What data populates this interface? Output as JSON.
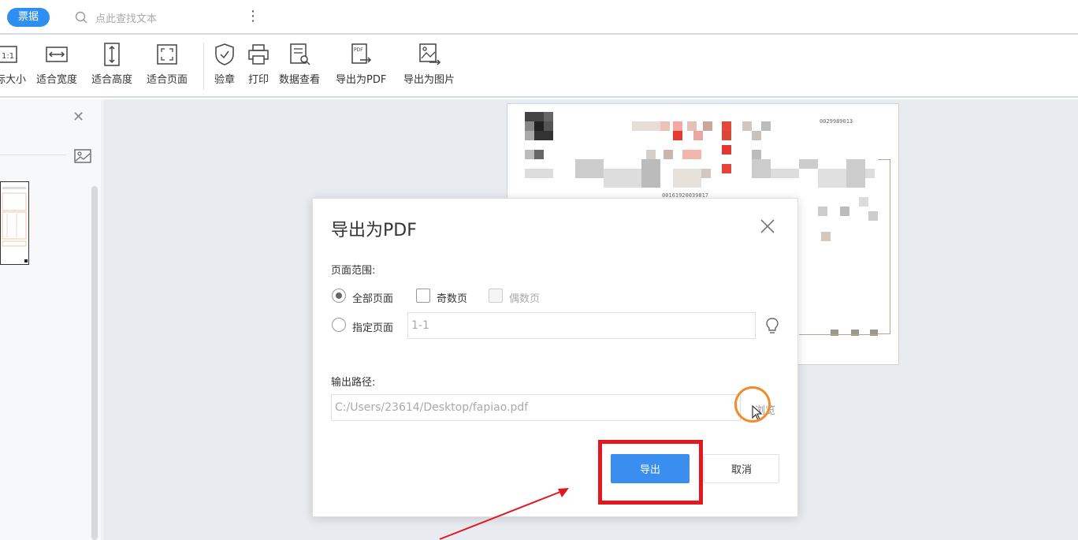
{
  "topbar": {
    "tag_label": "票据",
    "search_placeholder": "点此查找文本"
  },
  "toolbar": {
    "items": [
      {
        "label": "际大小",
        "icon": "actual-size-icon"
      },
      {
        "label": "适合宽度",
        "icon": "fit-width-icon"
      },
      {
        "label": "适合高度",
        "icon": "fit-height-icon"
      },
      {
        "label": "适合页面",
        "icon": "fit-page-icon"
      },
      {
        "label": "验章",
        "icon": "shield-check-icon"
      },
      {
        "label": "打印",
        "icon": "printer-icon"
      },
      {
        "label": "数据查看",
        "icon": "data-view-icon"
      },
      {
        "label": "导出为PDF",
        "icon": "export-pdf-icon"
      },
      {
        "label": "导出为图片",
        "icon": "export-image-icon"
      }
    ],
    "actual_size_glyph": "1:1",
    "pdf_glyph": "PDF"
  },
  "document": {
    "number_top": "0029989013",
    "number_mid": "00161920039817"
  },
  "dialog": {
    "title": "导出为PDF",
    "page_range_label": "页面范围:",
    "all_pages": "全部页面",
    "odd_pages": "奇数页",
    "even_pages": "偶数页",
    "specify_pages": "指定页面",
    "range_placeholder": "1-1",
    "output_path_label": "输出路径:",
    "output_path_value": "C:/Users/23614/Desktop/fapiao.pdf",
    "browse_label": "浏览",
    "export_button": "导出",
    "cancel_button": "取消"
  },
  "colors": {
    "accent": "#3a8ef0",
    "highlight_box": "#e4161e",
    "highlight_ring": "#f08c2c"
  }
}
